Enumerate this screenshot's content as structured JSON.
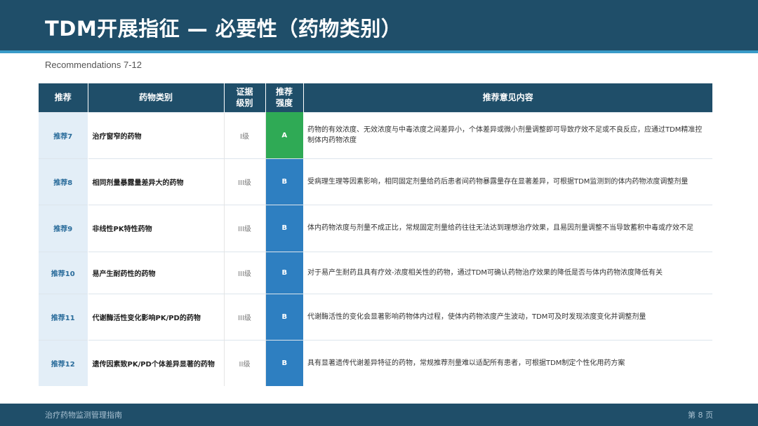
{
  "header": {
    "title": "TDM开展指征 — 必要性（药物类别）"
  },
  "subtitle": "Recommendations 7-12",
  "table": {
    "columns": [
      "推荐",
      "药物类别",
      "证据级别",
      "推荐强度",
      "推荐意见内容"
    ],
    "rows": [
      {
        "rec": "推荐7",
        "category": "治疗窗窄的药物",
        "level": "I级",
        "strength": "A",
        "content": "药物的有效浓度、无效浓度与中毒浓度之间差异小，个体差异或微小剂量调整即可导致疗效不足或不良反应，应通过TDM精准控制体内药物浓度"
      },
      {
        "rec": "推荐8",
        "category": "相同剂量暴露量差异大的药物",
        "level": "III级",
        "strength": "B",
        "content": "受病理生理等因素影响，相同固定剂量给药后患者间药物暴露量存在显著差异，可根据TDM监测到的体内药物浓度调整剂量"
      },
      {
        "rec": "推荐9",
        "category": "非线性PK特性药物",
        "level": "III级",
        "strength": "B",
        "content": "体内药物浓度与剂量不成正比，常规固定剂量给药往往无法达到理想治疗效果，且易因剂量调整不当导致蓄积中毒或疗效不足"
      },
      {
        "rec": "推荐10",
        "category": "易产生耐药性的药物",
        "level": "III级",
        "strength": "B",
        "content": "对于易产生耐药且具有疗效-浓度相关性的药物，通过TDM可确认药物治疗效果的降低是否与体内药物浓度降低有关"
      },
      {
        "rec": "推荐11",
        "category": "代谢酶活性变化影响PK/PD的药物",
        "level": "III级",
        "strength": "B",
        "content": "代谢酶活性的变化会显著影响药物体内过程，使体内药物浓度产生波动，TDM可及时发现浓度变化并调整剂量"
      },
      {
        "rec": "推荐12",
        "category": "遗传因素致PK/PD个体差异显著的药物",
        "level": "II级",
        "strength": "B",
        "content": "具有显著遗传代谢差异特征的药物，常规推荐剂量难以适配所有患者，可根据TDM制定个性化用药方案"
      }
    ]
  },
  "footer": {
    "left": "治疗药物监测管理指南",
    "right": "第 8 页"
  },
  "colors": {
    "primary": "#1f4e69",
    "accent": "#3a9bc8",
    "strength_a": "#2faa55",
    "strength_b": "#2e7fc1",
    "rec_cell": "#e3eef7"
  }
}
